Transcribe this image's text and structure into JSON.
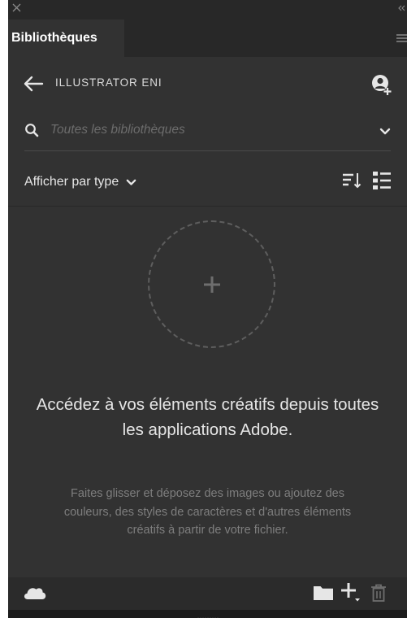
{
  "panel": {
    "tab_title": "Bibliothèques"
  },
  "header": {
    "library_name": "ILLUSTRATOR ENI"
  },
  "search": {
    "placeholder": "Toutes les bibliothèques",
    "value": ""
  },
  "view": {
    "dropdown_label": "Afficher par type"
  },
  "empty_state": {
    "headline": "Accédez à vos éléments créatifs depuis toutes les applications Adobe.",
    "description": "Faites glisser et déposez des images ou ajoutez des couleurs, des styles de caractères et d'autres éléments créatifs à partir de votre fichier."
  },
  "icons": {
    "close": "close-icon",
    "collapse": "collapse-icon",
    "panel_menu": "hamburger-icon",
    "back": "back-arrow-icon",
    "add_user": "add-user-icon",
    "search": "search-icon",
    "chevron": "chevron-down-icon",
    "sort": "sort-icon",
    "list_view": "list-view-icon",
    "add_asset": "plus-icon",
    "sync": "cloud-icon",
    "folder": "folder-icon",
    "add": "add-icon",
    "delete": "trash-icon"
  },
  "colors": {
    "panel_bg": "#323232",
    "tab_strip_bg": "#282828",
    "text_primary": "#e6e6e6",
    "text_muted": "#7e7e7e"
  }
}
